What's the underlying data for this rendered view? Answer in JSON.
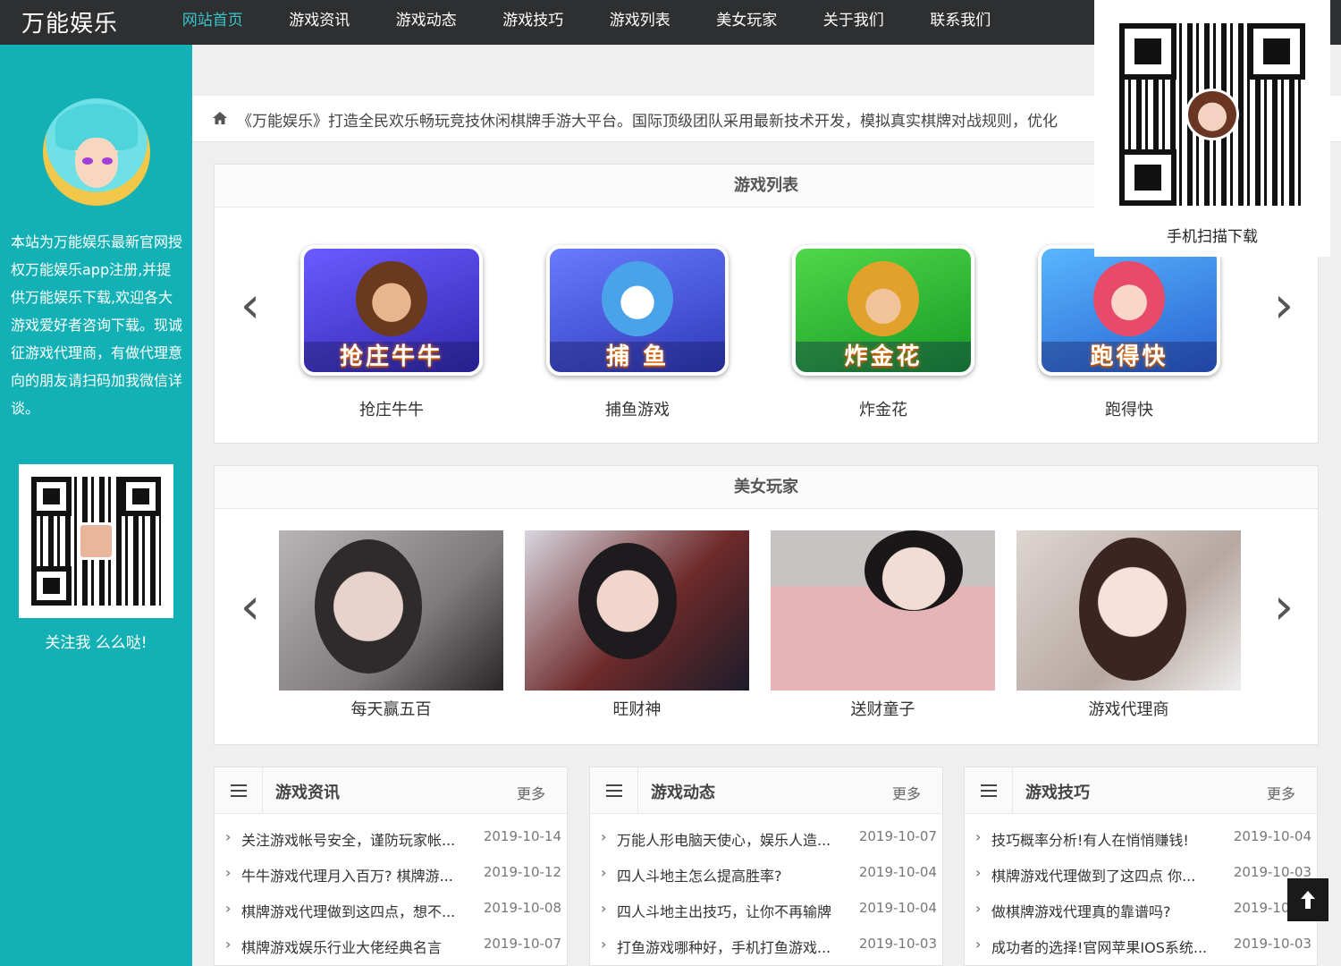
{
  "site": {
    "logo": "万能娱乐"
  },
  "nav": [
    {
      "label": "网站首页",
      "active": true
    },
    {
      "label": "游戏资讯"
    },
    {
      "label": "游戏动态"
    },
    {
      "label": "游戏技巧"
    },
    {
      "label": "游戏列表"
    },
    {
      "label": "美女玩家"
    },
    {
      "label": "关于我们"
    },
    {
      "label": "联系我们"
    }
  ],
  "sidebar": {
    "intro": "本站为万能娱乐最新官网授权万能娱乐app注册,并提供万能娱乐下载,欢迎各大游戏爱好者咨询下载。现诚征游戏代理商，有做代理意向的朋友请扫码加我微信详谈。",
    "follow": "关注我 么么哒!"
  },
  "float_qr": {
    "label": "手机扫描下载"
  },
  "notice": {
    "text": "《万能娱乐》打造全民欢乐畅玩竞技休闲棋牌手游大平台。国际顶级团队采用最新技术开发，模拟真实棋牌对战规则，优化"
  },
  "games": {
    "title": "游戏列表",
    "items": [
      {
        "label": "抢庄牛牛",
        "banner": "抢庄牛牛",
        "bg": "#4a3fd0"
      },
      {
        "label": "捕鱼游戏",
        "banner": "捕 鱼",
        "bg": "#3d52d8"
      },
      {
        "label": "炸金花",
        "banner": "炸金花",
        "bg": "#21b032"
      },
      {
        "label": "跑得快",
        "banner": "跑得快",
        "bg": "#2f8fe3"
      }
    ]
  },
  "players": {
    "title": "美女玩家",
    "items": [
      {
        "label": "每天赢五百"
      },
      {
        "label": "旺财神"
      },
      {
        "label": "送财童子"
      },
      {
        "label": "游戏代理商"
      }
    ]
  },
  "news": [
    {
      "title": "游戏资讯",
      "more": "更多",
      "rows": [
        {
          "title": "关注游戏帐号安全，谨防玩家帐...",
          "date": "2019-10-14"
        },
        {
          "title": "牛牛游戏代理月入百万? 棋牌游...",
          "date": "2019-10-12"
        },
        {
          "title": "棋牌游戏代理做到这四点，想不...",
          "date": "2019-10-08"
        },
        {
          "title": "棋牌游戏娱乐行业大佬经典名言",
          "date": "2019-10-07"
        }
      ]
    },
    {
      "title": "游戏动态",
      "more": "更多",
      "rows": [
        {
          "title": "万能人形电脑天使心，娱乐人造...",
          "date": "2019-10-07"
        },
        {
          "title": "四人斗地主怎么提高胜率?",
          "date": "2019-10-04"
        },
        {
          "title": "四人斗地主出技巧，让你不再输牌",
          "date": "2019-10-04"
        },
        {
          "title": "打鱼游戏哪种好，手机打鱼游戏...",
          "date": "2019-10-03"
        }
      ]
    },
    {
      "title": "游戏技巧",
      "more": "更多",
      "rows": [
        {
          "title": "技巧概率分析!有人在悄悄赚钱!",
          "date": "2019-10-04"
        },
        {
          "title": "棋牌游戏代理做到了这四点 你...",
          "date": "2019-10-03"
        },
        {
          "title": "做棋牌游戏代理真的靠谱吗?",
          "date": "2019-10-03"
        },
        {
          "title": "成功者的选择!官网苹果IOS系统...",
          "date": "2019-10-03"
        }
      ]
    }
  ],
  "colors": {
    "accent": "#13b1b5",
    "nav_bg": "#2e2f30",
    "nav_active": "#39c4c8"
  }
}
